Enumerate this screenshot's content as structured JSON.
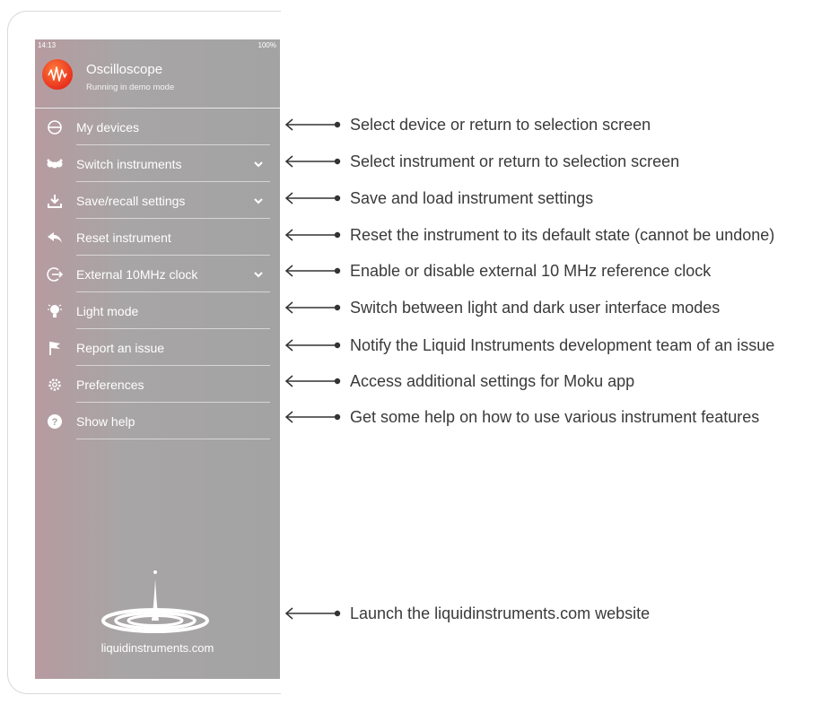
{
  "status_bar": {
    "time": "14:13",
    "battery": "100%"
  },
  "app": {
    "title": "Oscilloscope",
    "subtitle": "Running in demo mode",
    "icon": "waveform-icon"
  },
  "menu": [
    {
      "label": "My devices",
      "icon": "device-icon",
      "chevron": false
    },
    {
      "label": "Switch instruments",
      "icon": "switch-instruments-icon",
      "chevron": true
    },
    {
      "label": "Save/recall settings",
      "icon": "download-icon",
      "chevron": true
    },
    {
      "label": "Reset instrument",
      "icon": "reset-icon",
      "chevron": false
    },
    {
      "label": "External 10MHz clock",
      "icon": "external-clock-icon",
      "chevron": true
    },
    {
      "label": "Light mode",
      "icon": "lightbulb-icon",
      "chevron": false
    },
    {
      "label": "Report an issue",
      "icon": "flag-icon",
      "chevron": false
    },
    {
      "label": "Preferences",
      "icon": "gear-icon",
      "chevron": false
    },
    {
      "label": "Show help",
      "icon": "help-icon",
      "chevron": false
    }
  ],
  "footer": {
    "website": "liquidinstruments.com",
    "logo": "liquid-instruments-logo"
  },
  "annotations": [
    "Select device or return to selection screen",
    "Select instrument or return to selection screen",
    "Save and load instrument settings",
    "Reset the instrument to its default state (cannot be undone)",
    "Enable or disable external 10 MHz reference clock",
    "Switch between light and dark user interface modes",
    "Notify the Liquid Instruments development team of an issue",
    "Access additional settings for Moku app",
    "Get some help on how to use various instrument features",
    "Launch the liquidinstruments.com website"
  ]
}
